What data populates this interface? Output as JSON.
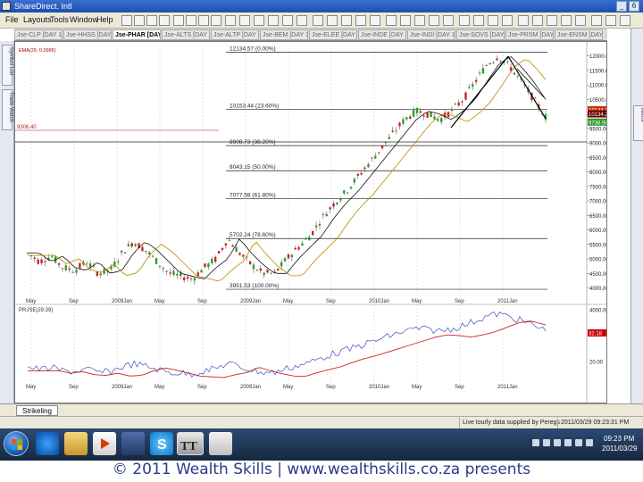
{
  "window": {
    "title": "ShareDirect. Intl",
    "controls": [
      "_",
      "6"
    ]
  },
  "menu": {
    "items": [
      "File",
      "Layouts",
      "Tools",
      "Window",
      "Help"
    ]
  },
  "tabs": [
    {
      "label": "Jse-CLP [DAY 1]",
      "active": false
    },
    {
      "label": "Jse-HHSS [DAY 1]",
      "active": false
    },
    {
      "label": "Jse-PHAR [DAY 1]",
      "active": true
    },
    {
      "label": "Jse-ALTS [DAY 1]",
      "active": false
    },
    {
      "label": "Jse-ALTP [DAY 1]",
      "active": false
    },
    {
      "label": "Jse-BEM [DAY 1]",
      "active": false
    },
    {
      "label": "Jse-ELEE [DAY 1]",
      "active": false
    },
    {
      "label": "Jse-INDE [DAY 1]",
      "active": false
    },
    {
      "label": "Jse-INDI [DAY 1]",
      "active": false
    },
    {
      "label": "Jse-SOVS [DAY 1]",
      "active": false
    },
    {
      "label": "Jse-PRSM [DAY 1]",
      "active": false
    },
    {
      "label": "Jse-ENSM [DAY 1]",
      "active": false
    }
  ],
  "left_panel": {
    "tabs": [
      "Symbol List",
      "Trade Watch"
    ]
  },
  "right_panel": {
    "tabs": [
      "Alerts"
    ]
  },
  "chart_data": [
    {
      "type": "candlestick",
      "title": "",
      "indicator_label": "EMA(20, 0.0995)",
      "price_marker": "9306.40",
      "x_tick_labels": [
        "May",
        "Sep",
        "2009Jan",
        "May",
        "Sep",
        "2009Jan",
        "May",
        "Sep",
        "2010Jan",
        "May",
        "Sep",
        "2011Jan"
      ],
      "y_tick_labels": [
        "12000.00",
        "11500.00",
        "11000.00",
        "10500.00",
        "10000.00",
        "9500.00",
        "9000.00",
        "8500.00",
        "8000.00",
        "7500.00",
        "7000.00",
        "6500.00",
        "6000.00",
        "5500.00",
        "5000.00",
        "4500.00",
        "4000.00"
      ],
      "ylim": [
        3800,
        12300
      ],
      "fib_levels": [
        {
          "label": "12134.57 (0.00%)",
          "value": 12134.57
        },
        {
          "label": "10153.44 (23.60%)",
          "value": 10153.44
        },
        {
          "label": "8908.73 (38.20%)",
          "value": 8908.73
        },
        {
          "label": "8043.15 (50.00%)",
          "value": 8043.15
        },
        {
          "label": "7077.58 (61.80%)",
          "value": 7077.58
        },
        {
          "label": "5702.24 (78.60%)",
          "value": 5702.24
        },
        {
          "label": "3951.53 (100.00%)",
          "value": 3951.53
        }
      ],
      "price_labels": [
        {
          "text": "10144.00",
          "value": 10144,
          "color": "#cc3300"
        },
        {
          "text": "10134.20",
          "value": 10004,
          "color": "#660000"
        },
        {
          "text": "9738.98",
          "value": 9720,
          "color": "#2a9a2a"
        }
      ],
      "close_path": [
        {
          "t": 0,
          "v": 5200
        },
        {
          "t": 3,
          "v": 4900
        },
        {
          "t": 6,
          "v": 5100
        },
        {
          "t": 9,
          "v": 4700
        },
        {
          "t": 12,
          "v": 4600
        },
        {
          "t": 15,
          "v": 4900
        },
        {
          "t": 18,
          "v": 4500
        },
        {
          "t": 21,
          "v": 4600
        },
        {
          "t": 24,
          "v": 5200
        },
        {
          "t": 27,
          "v": 5600
        },
        {
          "t": 30,
          "v": 5300
        },
        {
          "t": 33,
          "v": 4900
        },
        {
          "t": 36,
          "v": 4500
        },
        {
          "t": 39,
          "v": 4400
        },
        {
          "t": 42,
          "v": 4300
        },
        {
          "t": 45,
          "v": 4700
        },
        {
          "t": 48,
          "v": 5000
        },
        {
          "t": 51,
          "v": 5700
        },
        {
          "t": 54,
          "v": 5200
        },
        {
          "t": 57,
          "v": 4800
        },
        {
          "t": 60,
          "v": 4500
        },
        {
          "t": 63,
          "v": 4500
        },
        {
          "t": 66,
          "v": 5000
        },
        {
          "t": 69,
          "v": 5400
        },
        {
          "t": 72,
          "v": 5800
        },
        {
          "t": 75,
          "v": 6400
        },
        {
          "t": 78,
          "v": 6900
        },
        {
          "t": 81,
          "v": 7300
        },
        {
          "t": 84,
          "v": 7800
        },
        {
          "t": 87,
          "v": 8300
        },
        {
          "t": 90,
          "v": 8800
        },
        {
          "t": 93,
          "v": 9300
        },
        {
          "t": 96,
          "v": 9800
        },
        {
          "t": 99,
          "v": 10100
        },
        {
          "t": 102,
          "v": 10000
        },
        {
          "t": 105,
          "v": 9800
        },
        {
          "t": 108,
          "v": 10100
        },
        {
          "t": 111,
          "v": 10500
        },
        {
          "t": 114,
          "v": 11100
        },
        {
          "t": 117,
          "v": 11700
        },
        {
          "t": 120,
          "v": 12000
        },
        {
          "t": 123,
          "v": 11600
        },
        {
          "t": 126,
          "v": 11100
        },
        {
          "t": 129,
          "v": 10500
        },
        {
          "t": 132,
          "v": 9900
        }
      ],
      "lower_panel": {
        "label": "PRJSE(29.39)",
        "y_tick_labels": [
          "4000.00",
          "32.18",
          "20.00"
        ],
        "price_label": {
          "text": "32.18",
          "color": "#cc0000"
        },
        "x_tick_labels": [
          "May",
          "Sep",
          "2009Jan",
          "May",
          "Sep",
          "2009Jan",
          "May",
          "Sep",
          "2010Jan",
          "May",
          "Sep",
          "2011Jan"
        ]
      }
    }
  ],
  "sheet_tab": "Strikeling",
  "status": {
    "message": "Live tourly data supplied by Peregs",
    "datetime": "2011/03/29 09:23:31 PM"
  },
  "taskbar": {
    "clock_time": "09:23 PM",
    "clock_date": "2011/03/29"
  },
  "footer": {
    "text": "© 2011 Wealth Skills | www.wealthskills.co.za presents"
  }
}
